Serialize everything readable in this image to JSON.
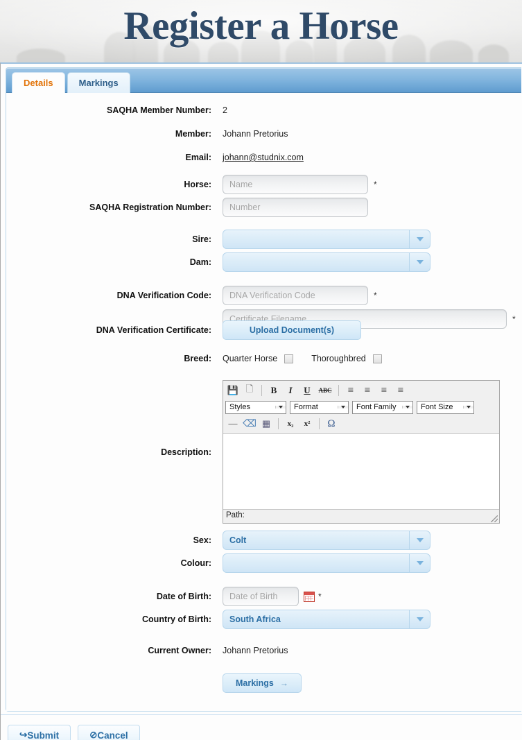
{
  "banner": {
    "title": "Register a Horse"
  },
  "tabs": [
    {
      "label": "Details",
      "active": true
    },
    {
      "label": "Markings",
      "active": false
    }
  ],
  "form": {
    "member_number": {
      "label": "SAQHA Member Number:",
      "value": "2"
    },
    "member": {
      "label": "Member:",
      "value": "Johann Pretorius"
    },
    "email": {
      "label": "Email:",
      "value": "johann@studnix.com"
    },
    "horse": {
      "label": "Horse:",
      "placeholder": "Name",
      "value": "",
      "required": "*"
    },
    "registration": {
      "label": "SAQHA Registration Number:",
      "placeholder": "Number",
      "value": ""
    },
    "sire": {
      "label": "Sire:",
      "value": ""
    },
    "dam": {
      "label": "Dam:",
      "value": ""
    },
    "dna_code": {
      "label": "DNA Verification Code:",
      "placeholder": "DNA Verification Code",
      "value": "",
      "required": "*"
    },
    "dna_cert": {
      "label": "DNA Verification Certificate:",
      "placeholder": "Certificate Filename",
      "value": "",
      "required": "*",
      "upload_label": "Upload Document(s)"
    },
    "breed": {
      "label": "Breed:",
      "options": [
        {
          "label": "Quarter Horse",
          "checked": false
        },
        {
          "label": "Thoroughbred",
          "checked": false
        }
      ]
    },
    "description": {
      "label": "Description:",
      "value": ""
    },
    "sex": {
      "label": "Sex:",
      "value": "Colt"
    },
    "colour": {
      "label": "Colour:",
      "value": ""
    },
    "dob": {
      "label": "Date of Birth:",
      "placeholder": "Date of Birth",
      "value": "",
      "required": "*"
    },
    "country": {
      "label": "Country of Birth:",
      "value": "South Africa"
    },
    "owner": {
      "label": "Current Owner:",
      "value": "Johann Pretorius"
    },
    "markings_button": {
      "label": "Markings",
      "arrow": "→"
    }
  },
  "editor": {
    "row1": [
      {
        "name": "save-icon",
        "glyph": "💾"
      },
      {
        "name": "new-document-icon",
        "glyph": "🗋"
      },
      {
        "name": "bold-icon",
        "glyph": "B"
      },
      {
        "name": "italic-icon",
        "glyph": "I"
      },
      {
        "name": "underline-icon",
        "glyph": "U"
      },
      {
        "name": "strikethrough-icon",
        "glyph": "ABC"
      },
      {
        "name": "align-left-icon",
        "glyph": "≡"
      },
      {
        "name": "align-center-icon",
        "glyph": "≡"
      },
      {
        "name": "align-right-icon",
        "glyph": "≡"
      },
      {
        "name": "align-justify-icon",
        "glyph": "≡"
      }
    ],
    "selects": [
      {
        "name": "styles-select",
        "label": "Styles"
      },
      {
        "name": "format-select",
        "label": "Format"
      },
      {
        "name": "font-family-select",
        "label": "Font Family"
      },
      {
        "name": "font-size-select",
        "label": "Font Size"
      }
    ],
    "row3": [
      {
        "name": "horizontal-rule-icon",
        "glyph": "—"
      },
      {
        "name": "remove-format-icon",
        "glyph": "⌫"
      },
      {
        "name": "insert-table-icon",
        "glyph": "▦"
      },
      {
        "name": "subscript-icon",
        "glyph": "x₂"
      },
      {
        "name": "superscript-icon",
        "glyph": "x²"
      },
      {
        "name": "special-character-icon",
        "glyph": "Ω"
      }
    ],
    "path_label": "Path:"
  },
  "footer": {
    "submit": {
      "label": "Submit",
      "icon": "↪"
    },
    "cancel": {
      "label": "Cancel",
      "icon": "⊘"
    }
  },
  "colors": {
    "accent_orange": "#e2740a",
    "link_blue": "#2c6fa5",
    "tab_blue": "#7fb3dd",
    "title_navy": "#2f4a68"
  }
}
